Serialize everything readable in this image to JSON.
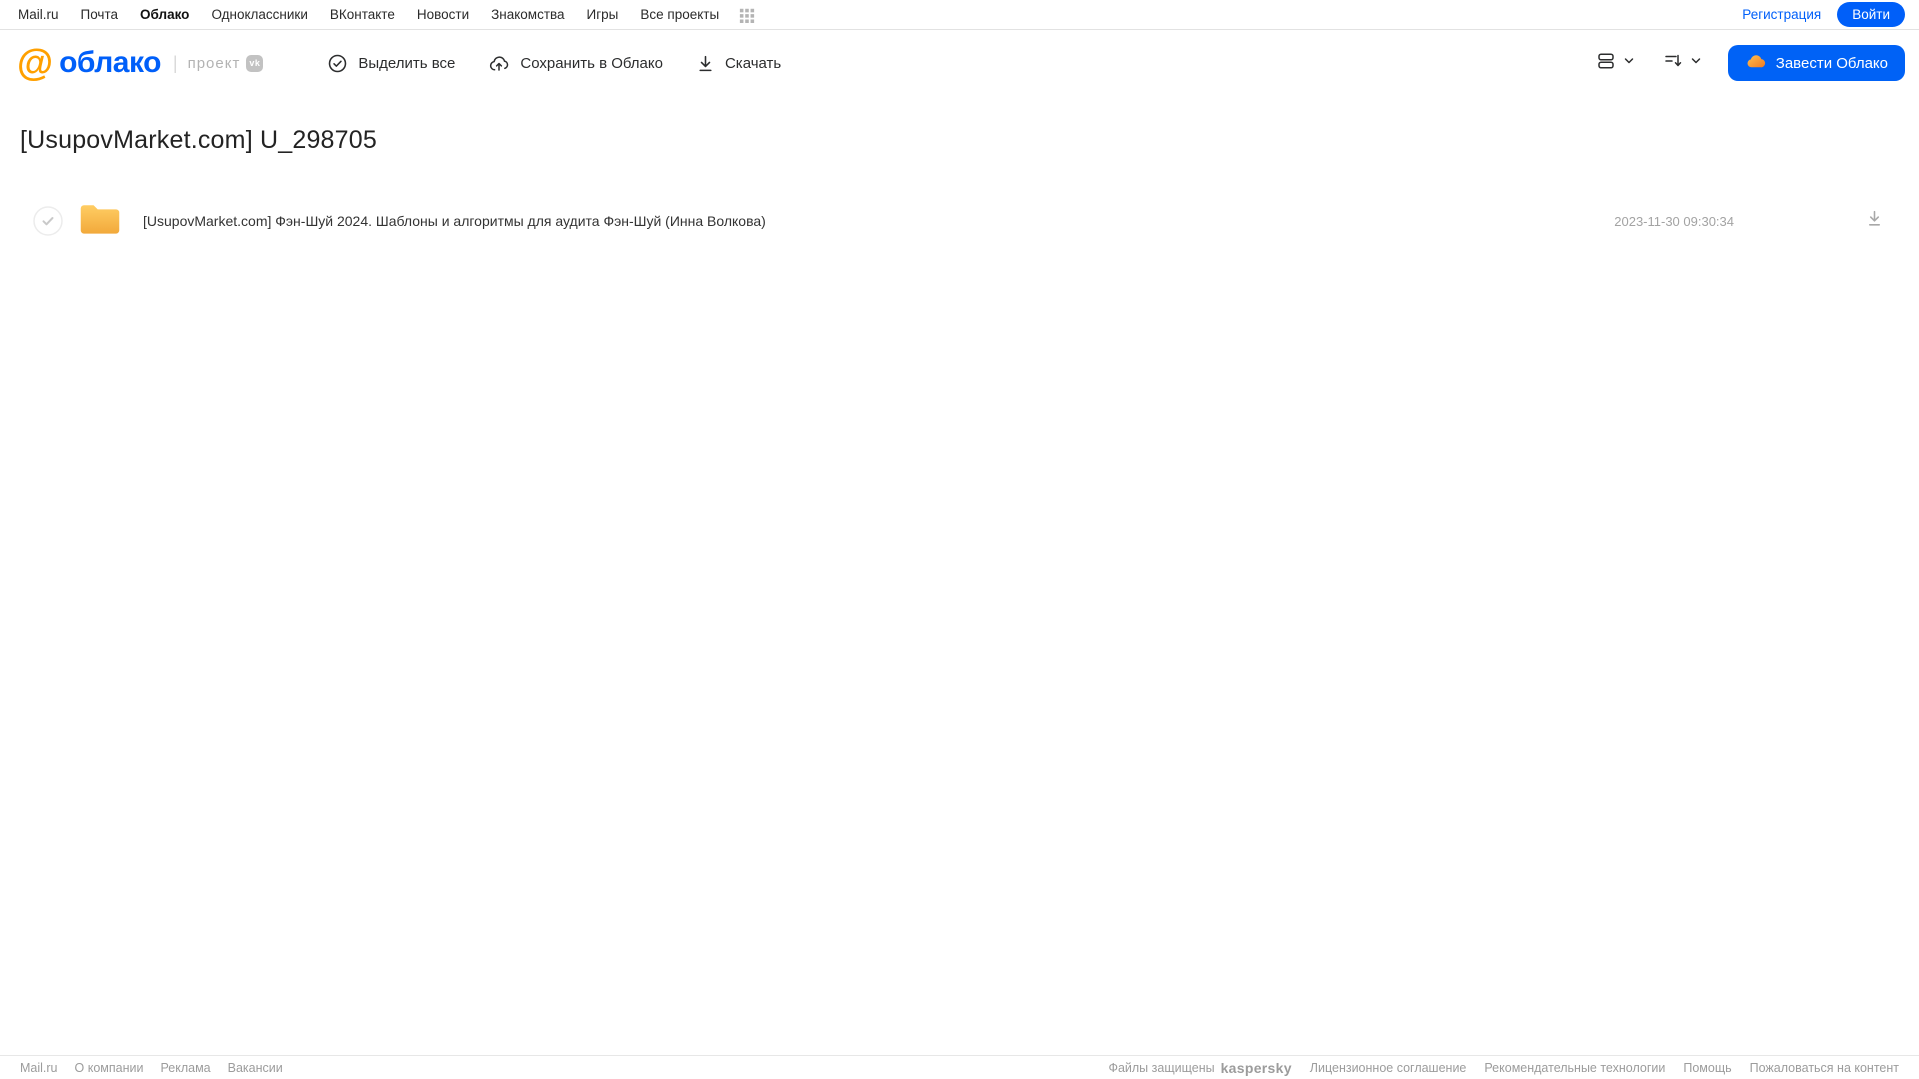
{
  "topbar": {
    "nav": [
      "Mail.ru",
      "Почта",
      "Облако",
      "Одноклассники",
      "ВКонтакте",
      "Новости",
      "Знакомства",
      "Игры",
      "Все проекты"
    ],
    "registration_label": "Регистрация",
    "login_label": "Войти"
  },
  "header": {
    "logo": {
      "at": "@",
      "name": "облако",
      "project": "проект",
      "badge": "vk"
    },
    "actions": {
      "select_all": "Выделить все",
      "save_to_cloud": "Сохранить в Облако",
      "download": "Скачать"
    },
    "cta_label": "Завести Облако"
  },
  "main": {
    "title": "[UsupovMarket.com] U_298705",
    "files": [
      {
        "name": "[UsupovMarket.com] Фэн-Шуй 2024. Шаблоны и алгоритмы для аудита Фэн-Шуй (Инна Волкова)",
        "date": "2023-11-30 09:30:34"
      }
    ]
  },
  "footer": {
    "left": [
      "Mail.ru",
      "О компании",
      "Реклама",
      "Вакансии"
    ],
    "protected_label": "Файлы защищены",
    "kaspersky_label": "kaspersky",
    "right": [
      "Лицензионное соглашение",
      "Рекомендательные технологии",
      "Помощь",
      "Пожаловаться на контент"
    ]
  },
  "icons": {
    "apps_grid": "apps-grid-icon",
    "check_circle": "check-circle-icon",
    "cloud_upload": "cloud-upload-icon",
    "download_arrow": "download-icon",
    "view_mode": "view-mode-icon",
    "sort": "sort-icon",
    "chevron": "chevron-down-icon",
    "cloud": "cloud-icon",
    "folder": "folder-icon"
  },
  "colors": {
    "accent_blue": "#005ff9",
    "cta_blue": "#0062f6",
    "logo_orange": "#ffa000",
    "folder_yellow": "#f8b84e",
    "kaspersky_green": "#00a88e"
  }
}
